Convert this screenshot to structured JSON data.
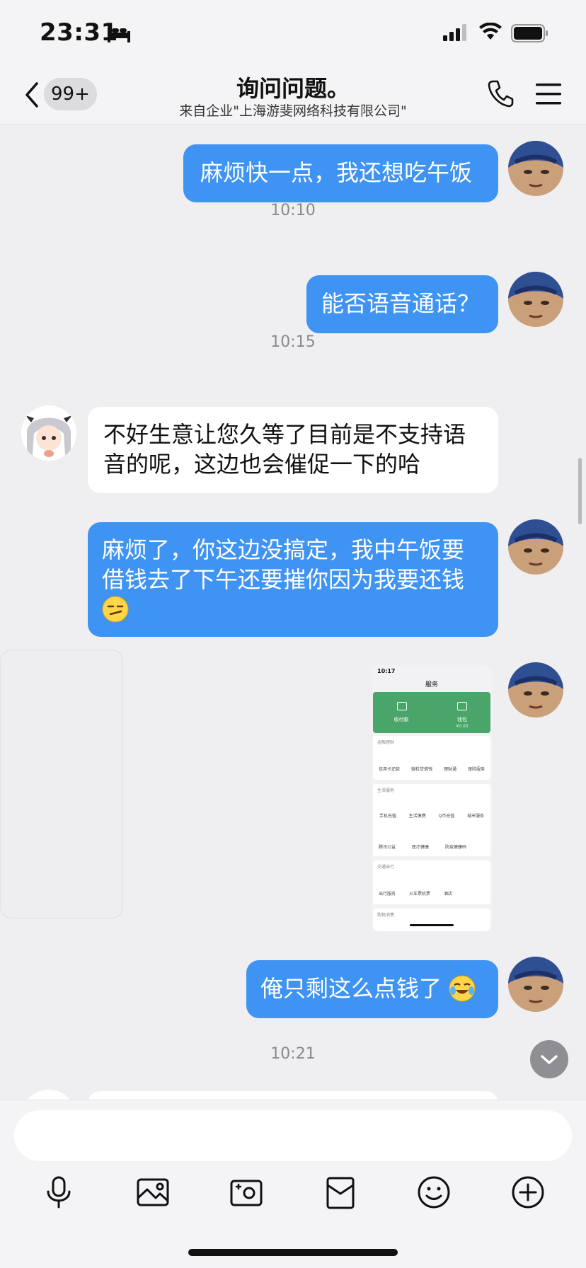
{
  "status_bar": {
    "time": "23:31"
  },
  "header": {
    "badge": "99+",
    "title": "询问问题。",
    "subtitle": "来自企业\"上海游斐网络科技有限公司\""
  },
  "messages": [
    {
      "kind": "out",
      "text": "麻烦快一点，我还想吃午饭"
    },
    {
      "kind": "time",
      "text": "10:10"
    },
    {
      "kind": "out",
      "text": "能否语音通话？"
    },
    {
      "kind": "time",
      "text": "10:15"
    },
    {
      "kind": "in",
      "text": "不好生意让您久等了目前是不支持语音的呢，这边也会催促一下的哈"
    },
    {
      "kind": "out",
      "text": "麻烦了，你这边没搞定，我中午饭要借钱去了下午还要摧你因为我要还钱"
    },
    {
      "kind": "out",
      "text": "俺只剩这么点钱了"
    },
    {
      "kind": "time",
      "text": "10:21"
    }
  ],
  "screenshot": {
    "time": "10:17",
    "title": "服务",
    "top_actions": [
      "收付款",
      "钱包"
    ],
    "wallet_amount": "¥0.00",
    "sections": [
      {
        "title": "金融理财",
        "items": [
          "信用卡还款",
          "微粒贷借钱",
          "理财通",
          "保险服务"
        ]
      },
      {
        "title": "生活服务",
        "items": [
          "手机充值",
          "生活缴费",
          "Q币充值",
          "城市服务",
          "腾讯公益",
          "医疗健康",
          "防疫健康码"
        ]
      },
      {
        "title": "交通出行",
        "items": [
          "出行服务",
          "火车票机票",
          "酒店"
        ]
      },
      {
        "title": "购物消费",
        "items": []
      }
    ]
  },
  "input": {
    "placeholder": ""
  },
  "toolbar": [
    "mic-icon",
    "image-icon",
    "camera-icon",
    "red-packet-icon",
    "emoji-icon",
    "plus-icon"
  ],
  "colors": {
    "outgoing_bubble": "#3f93f2",
    "incoming_bubble": "#ffffff",
    "background": "#efeff1"
  }
}
